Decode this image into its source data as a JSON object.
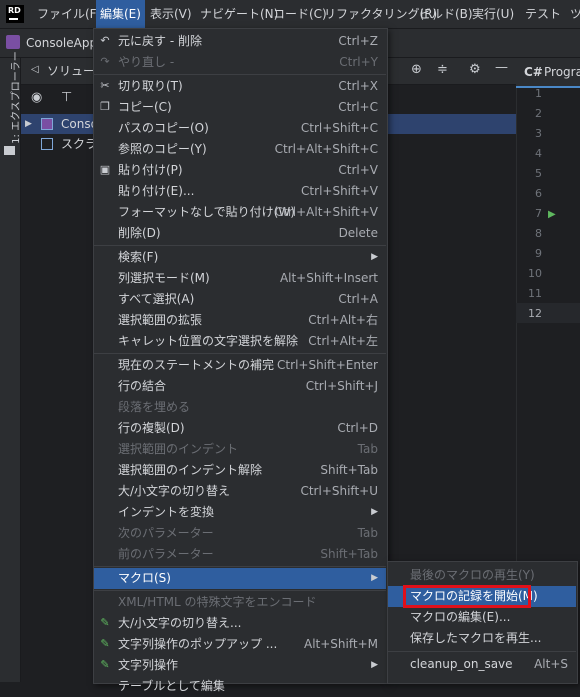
{
  "app": {
    "logo": "RD"
  },
  "menubar": [
    {
      "label": "ファイル(F)",
      "active": false
    },
    {
      "label": "編集(E)",
      "active": true
    },
    {
      "label": "表示(V)",
      "active": false
    },
    {
      "label": "ナビゲート(N)",
      "active": false
    },
    {
      "label": "コード(C)",
      "active": false
    },
    {
      "label": "リファクタリング(R)",
      "active": false
    },
    {
      "label": "ビルド(B)",
      "active": false
    },
    {
      "label": "実行(U)",
      "active": false
    },
    {
      "label": "テスト",
      "active": false
    },
    {
      "label": "ツ",
      "active": false
    }
  ],
  "toolbar": {
    "project": "ConsoleApp"
  },
  "stripe": {
    "label": "1: エクスプローラー"
  },
  "explorer": {
    "title": "ソリューショ",
    "tree": [
      {
        "label": "Console",
        "selected": true
      },
      {
        "label": "スクラッ",
        "selected": false
      }
    ]
  },
  "editor": {
    "tab": "Progra",
    "tab_prefix": "C#",
    "lines": [
      "1",
      "2",
      "3",
      "4",
      "5",
      "6",
      "7",
      "8",
      "9",
      "10",
      "11",
      "12"
    ],
    "current_line": "12"
  },
  "edit_menu": [
    {
      "label": "元に戻す - 削除",
      "shortcut": "Ctrl+Z",
      "disabled": false,
      "icon": "undo-icon"
    },
    {
      "label": "やり直し -",
      "shortcut": "Ctrl+Y",
      "disabled": true,
      "icon": "redo-icon"
    },
    {
      "sep": true
    },
    {
      "label": "切り取り(T)",
      "shortcut": "Ctrl+X",
      "disabled": false,
      "icon": "scissors-icon"
    },
    {
      "label": "コピー(C)",
      "shortcut": "Ctrl+C",
      "disabled": false,
      "icon": "copy-icon"
    },
    {
      "label": "パスのコピー(O)",
      "shortcut": "Ctrl+Shift+C",
      "disabled": false
    },
    {
      "label": "参照のコピー(Y)",
      "shortcut": "Ctrl+Alt+Shift+C",
      "disabled": false
    },
    {
      "label": "貼り付け(P)",
      "shortcut": "Ctrl+V",
      "disabled": false,
      "icon": "clipboard-icon"
    },
    {
      "label": "貼り付け(E)...",
      "shortcut": "Ctrl+Shift+V",
      "disabled": false
    },
    {
      "label": "フォーマットなしで貼り付け(W)",
      "shortcut": "Ctrl+Alt+Shift+V",
      "disabled": false
    },
    {
      "label": "削除(D)",
      "shortcut": "Delete",
      "disabled": false
    },
    {
      "sep": true
    },
    {
      "label": "検索(F)",
      "shortcut": "",
      "disabled": false,
      "submenu": true
    },
    {
      "label": "列選択モード(M)",
      "shortcut": "Alt+Shift+Insert",
      "disabled": false
    },
    {
      "label": "すべて選択(A)",
      "shortcut": "Ctrl+A",
      "disabled": false
    },
    {
      "label": "選択範囲の拡張",
      "shortcut": "Ctrl+Alt+右",
      "disabled": false
    },
    {
      "label": "キャレット位置の文字選択を解除",
      "shortcut": "Ctrl+Alt+左",
      "disabled": false
    },
    {
      "sep": true
    },
    {
      "label": "現在のステートメントの補完",
      "shortcut": "Ctrl+Shift+Enter",
      "disabled": false
    },
    {
      "label": "行の結合",
      "shortcut": "Ctrl+Shift+J",
      "disabled": false
    },
    {
      "label": "段落を埋める",
      "shortcut": "",
      "disabled": true
    },
    {
      "label": "行の複製(D)",
      "shortcut": "Ctrl+D",
      "disabled": false
    },
    {
      "label": "選択範囲のインデント",
      "shortcut": "Tab",
      "disabled": true
    },
    {
      "label": "選択範囲のインデント解除",
      "shortcut": "Shift+Tab",
      "disabled": false
    },
    {
      "label": "大/小文字の切り替え",
      "shortcut": "Ctrl+Shift+U",
      "disabled": false
    },
    {
      "label": "インデントを変換",
      "shortcut": "",
      "disabled": false,
      "submenu": true
    },
    {
      "label": "次のパラメーター",
      "shortcut": "Tab",
      "disabled": true
    },
    {
      "label": "前のパラメーター",
      "shortcut": "Shift+Tab",
      "disabled": true
    },
    {
      "sep": true
    },
    {
      "label": "マクロ(S)",
      "shortcut": "",
      "disabled": false,
      "submenu": true,
      "highlighted": true
    },
    {
      "sep": true
    },
    {
      "label": "XML/HTML の特殊文字をエンコード",
      "shortcut": "",
      "disabled": true
    },
    {
      "label": "大/小文字の切り替え...",
      "shortcut": "",
      "disabled": false,
      "icon": "pencil-icon"
    },
    {
      "label": "文字列操作のポップアップ ...",
      "shortcut": "Alt+Shift+M",
      "disabled": false,
      "icon": "pencil-icon"
    },
    {
      "label": "文字列操作",
      "shortcut": "",
      "disabled": false,
      "submenu": true,
      "icon": "pencil-icon"
    },
    {
      "label": "テーブルとして編集",
      "shortcut": "",
      "disabled": false
    }
  ],
  "macro_menu": [
    {
      "label": "最後のマクロの再生(Y)",
      "shortcut": "",
      "disabled": true
    },
    {
      "label": "マクロの記録を開始(M)",
      "shortcut": "",
      "disabled": false,
      "highlighted": true
    },
    {
      "label": "マクロの編集(E)...",
      "shortcut": "",
      "disabled": false
    },
    {
      "label": "保存したマクロを再生...",
      "shortcut": "",
      "disabled": false
    },
    {
      "sep": true
    },
    {
      "label": "cleanup_on_save",
      "shortcut": "Alt+S",
      "disabled": false
    }
  ],
  "colors": {
    "highlight": "#2f5e9f",
    "annotation": "#e0101a",
    "accent": "#4a88c7"
  }
}
